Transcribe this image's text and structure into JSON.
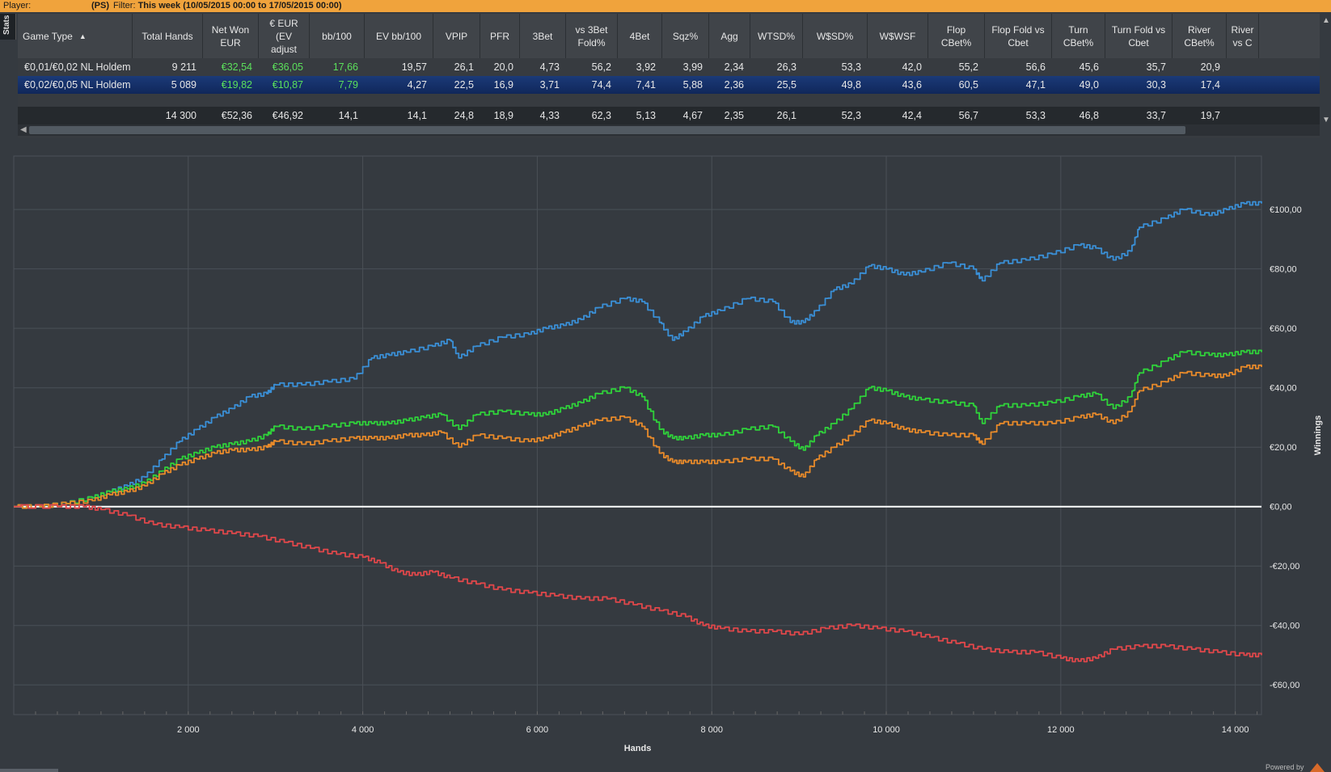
{
  "filterbar": {
    "player_label": "Player:",
    "site": "(PS)",
    "filter_label": "Filter:",
    "filter_value": "This week (10/05/2015 00:00 to 17/05/2015 00:00)"
  },
  "stats_tab": "Stats",
  "table": {
    "columns": [
      {
        "label": "Game Type",
        "sorted": true
      },
      {
        "label": "Total Hands"
      },
      {
        "label": "Net Won EUR"
      },
      {
        "label": "€ EUR (EV adjust"
      },
      {
        "label": "bb/100"
      },
      {
        "label": "EV bb/100"
      },
      {
        "label": "VPIP"
      },
      {
        "label": "PFR"
      },
      {
        "label": "3Bet"
      },
      {
        "label": "vs 3Bet Fold%"
      },
      {
        "label": "4Bet"
      },
      {
        "label": "Sqz%"
      },
      {
        "label": "Agg"
      },
      {
        "label": "WTSD%"
      },
      {
        "label": "W$SD%"
      },
      {
        "label": "W$WSF"
      },
      {
        "label": "Flop CBet%"
      },
      {
        "label": "Flop Fold vs Cbet"
      },
      {
        "label": "Turn CBet%"
      },
      {
        "label": "Turn Fold vs Cbet"
      },
      {
        "label": "River CBet%"
      },
      {
        "label": "River vs C"
      }
    ],
    "rows": [
      [
        "€0,01/€0,02 NL Holdem",
        "9 211",
        "€32,54",
        "€36,05",
        "17,66",
        "19,57",
        "26,1",
        "20,0",
        "4,73",
        "56,2",
        "3,92",
        "3,99",
        "2,34",
        "26,3",
        "53,3",
        "42,0",
        "55,2",
        "56,6",
        "45,6",
        "35,7",
        "20,9",
        ""
      ],
      [
        "€0,02/€0,05 NL Holdem",
        "5 089",
        "€19,82",
        "€10,87",
        "7,79",
        "4,27",
        "22,5",
        "16,9",
        "3,71",
        "74,4",
        "7,41",
        "5,88",
        "2,36",
        "25,5",
        "49,8",
        "43,6",
        "60,5",
        "47,1",
        "49,0",
        "30,3",
        "17,4",
        ""
      ]
    ],
    "totals": [
      "",
      "14 300",
      "€52,36",
      "€46,92",
      "14,1",
      "14,1",
      "24,8",
      "18,9",
      "4,33",
      "62,3",
      "5,13",
      "4,67",
      "2,35",
      "26,1",
      "52,3",
      "42,4",
      "56,7",
      "53,3",
      "46,8",
      "33,7",
      "19,7",
      ""
    ]
  },
  "colors": {
    "blue": "#3a8fd6",
    "green": "#2fd23a",
    "orange": "#e88a2a",
    "red": "#e0474a",
    "zero": "#ffffff",
    "positive_value": "#5be05b"
  },
  "chart_data": {
    "type": "line",
    "xlabel": "Hands",
    "ylabel": "Winnings",
    "xlim": [
      0,
      14300
    ],
    "ylim": [
      -70,
      118
    ],
    "x_ticks": [
      {
        "value": 2000,
        "label": "2 000"
      },
      {
        "value": 4000,
        "label": "4 000"
      },
      {
        "value": 6000,
        "label": "6 000"
      },
      {
        "value": 8000,
        "label": "8 000"
      },
      {
        "value": 10000,
        "label": "10 000"
      },
      {
        "value": 12000,
        "label": "12 000"
      },
      {
        "value": 14000,
        "label": "14 000"
      }
    ],
    "y_ticks": [
      {
        "value": 100,
        "label": "€100,00"
      },
      {
        "value": 80,
        "label": "€80,00"
      },
      {
        "value": 60,
        "label": "€60,00"
      },
      {
        "value": 40,
        "label": "€40,00"
      },
      {
        "value": 20,
        "label": "€20,00"
      },
      {
        "value": 0,
        "label": "€0,00"
      },
      {
        "value": -20,
        "label": "-€20,00"
      },
      {
        "value": -40,
        "label": "-€40,00"
      },
      {
        "value": -60,
        "label": "-€60,00"
      }
    ],
    "grid": true,
    "series": [
      {
        "color": "#3a8fd6",
        "points": [
          [
            0,
            0
          ],
          [
            300,
            0
          ],
          [
            600,
            1
          ],
          [
            900,
            3
          ],
          [
            1100,
            5
          ],
          [
            1300,
            7
          ],
          [
            1500,
            10
          ],
          [
            1700,
            16
          ],
          [
            1900,
            22
          ],
          [
            2100,
            26
          ],
          [
            2300,
            30
          ],
          [
            2500,
            33
          ],
          [
            2700,
            37
          ],
          [
            2900,
            38
          ],
          [
            3000,
            41
          ],
          [
            3300,
            41
          ],
          [
            3600,
            42
          ],
          [
            3900,
            43
          ],
          [
            4100,
            50
          ],
          [
            4300,
            51
          ],
          [
            4500,
            52
          ],
          [
            4800,
            54
          ],
          [
            5000,
            56
          ],
          [
            5100,
            50
          ],
          [
            5300,
            54
          ],
          [
            5600,
            57
          ],
          [
            5900,
            58
          ],
          [
            6100,
            60
          ],
          [
            6300,
            61
          ],
          [
            6500,
            63
          ],
          [
            6700,
            67
          ],
          [
            7000,
            70
          ],
          [
            7200,
            69
          ],
          [
            7400,
            62
          ],
          [
            7550,
            56
          ],
          [
            7700,
            59
          ],
          [
            7900,
            64
          ],
          [
            8100,
            66
          ],
          [
            8400,
            70
          ],
          [
            8700,
            69
          ],
          [
            8900,
            62
          ],
          [
            9050,
            62
          ],
          [
            9200,
            66
          ],
          [
            9400,
            73
          ],
          [
            9600,
            75
          ],
          [
            9800,
            81
          ],
          [
            10000,
            80
          ],
          [
            10200,
            78
          ],
          [
            10400,
            79
          ],
          [
            10700,
            82
          ],
          [
            11000,
            80
          ],
          [
            11100,
            76
          ],
          [
            11300,
            82
          ],
          [
            11600,
            83
          ],
          [
            11900,
            85
          ],
          [
            12200,
            88
          ],
          [
            12400,
            87
          ],
          [
            12600,
            83
          ],
          [
            12800,
            86
          ],
          [
            12900,
            94
          ],
          [
            13200,
            97
          ],
          [
            13400,
            100
          ],
          [
            13700,
            98
          ],
          [
            13900,
            100
          ],
          [
            14100,
            102
          ],
          [
            14300,
            102
          ]
        ]
      },
      {
        "color": "#2fd23a",
        "points": [
          [
            0,
            0
          ],
          [
            300,
            0
          ],
          [
            600,
            1
          ],
          [
            900,
            3
          ],
          [
            1100,
            5
          ],
          [
            1300,
            6
          ],
          [
            1500,
            8
          ],
          [
            1700,
            12
          ],
          [
            1900,
            16
          ],
          [
            2100,
            18
          ],
          [
            2300,
            20
          ],
          [
            2500,
            21
          ],
          [
            2700,
            22
          ],
          [
            2900,
            24
          ],
          [
            3000,
            27
          ],
          [
            3300,
            26
          ],
          [
            3600,
            27
          ],
          [
            3900,
            28
          ],
          [
            4100,
            28
          ],
          [
            4300,
            28
          ],
          [
            4500,
            29
          ],
          [
            4700,
            30
          ],
          [
            4900,
            31
          ],
          [
            5100,
            26
          ],
          [
            5300,
            31
          ],
          [
            5600,
            32
          ],
          [
            5900,
            31
          ],
          [
            6100,
            31
          ],
          [
            6300,
            33
          ],
          [
            6500,
            35
          ],
          [
            6700,
            38
          ],
          [
            7000,
            40
          ],
          [
            7200,
            37
          ],
          [
            7400,
            26
          ],
          [
            7550,
            23
          ],
          [
            7700,
            23
          ],
          [
            7900,
            24
          ],
          [
            8100,
            24
          ],
          [
            8400,
            26
          ],
          [
            8700,
            27
          ],
          [
            8900,
            22
          ],
          [
            9050,
            19
          ],
          [
            9200,
            24
          ],
          [
            9400,
            28
          ],
          [
            9600,
            33
          ],
          [
            9800,
            40
          ],
          [
            10000,
            39
          ],
          [
            10200,
            37
          ],
          [
            10400,
            36
          ],
          [
            10700,
            35
          ],
          [
            11000,
            34
          ],
          [
            11100,
            28
          ],
          [
            11300,
            34
          ],
          [
            11600,
            34
          ],
          [
            11900,
            35
          ],
          [
            12200,
            37
          ],
          [
            12400,
            38
          ],
          [
            12600,
            33
          ],
          [
            12800,
            37
          ],
          [
            12900,
            45
          ],
          [
            13200,
            49
          ],
          [
            13400,
            52
          ],
          [
            13700,
            51
          ],
          [
            13900,
            51
          ],
          [
            14100,
            52
          ],
          [
            14300,
            52
          ]
        ]
      },
      {
        "color": "#e88a2a",
        "points": [
          [
            0,
            0
          ],
          [
            300,
            0
          ],
          [
            600,
            1
          ],
          [
            900,
            2
          ],
          [
            1100,
            4
          ],
          [
            1300,
            5
          ],
          [
            1500,
            7
          ],
          [
            1700,
            11
          ],
          [
            1900,
            14
          ],
          [
            2100,
            16
          ],
          [
            2300,
            18
          ],
          [
            2500,
            19
          ],
          [
            2700,
            19
          ],
          [
            2900,
            20
          ],
          [
            3000,
            22
          ],
          [
            3300,
            21
          ],
          [
            3600,
            22
          ],
          [
            3900,
            23
          ],
          [
            4100,
            23
          ],
          [
            4300,
            23
          ],
          [
            4500,
            24
          ],
          [
            4700,
            24
          ],
          [
            4900,
            25
          ],
          [
            5100,
            20
          ],
          [
            5300,
            24
          ],
          [
            5600,
            23
          ],
          [
            5900,
            22
          ],
          [
            6100,
            23
          ],
          [
            6300,
            25
          ],
          [
            6500,
            27
          ],
          [
            6700,
            29
          ],
          [
            7000,
            30
          ],
          [
            7200,
            27
          ],
          [
            7400,
            18
          ],
          [
            7550,
            15
          ],
          [
            7700,
            15
          ],
          [
            7900,
            15
          ],
          [
            8100,
            15
          ],
          [
            8400,
            16
          ],
          [
            8700,
            16
          ],
          [
            8900,
            12
          ],
          [
            9050,
            10
          ],
          [
            9200,
            16
          ],
          [
            9400,
            20
          ],
          [
            9600,
            24
          ],
          [
            9800,
            29
          ],
          [
            10000,
            28
          ],
          [
            10200,
            26
          ],
          [
            10400,
            25
          ],
          [
            10700,
            24
          ],
          [
            11000,
            24
          ],
          [
            11100,
            21
          ],
          [
            11300,
            28
          ],
          [
            11600,
            28
          ],
          [
            11900,
            28
          ],
          [
            12200,
            30
          ],
          [
            12400,
            31
          ],
          [
            12600,
            28
          ],
          [
            12800,
            32
          ],
          [
            12900,
            39
          ],
          [
            13200,
            42
          ],
          [
            13400,
            45
          ],
          [
            13700,
            44
          ],
          [
            13900,
            44
          ],
          [
            14100,
            47
          ],
          [
            14300,
            47
          ]
        ]
      },
      {
        "color": "#e0474a",
        "points": [
          [
            0,
            0
          ],
          [
            500,
            0
          ],
          [
            800,
            0
          ],
          [
            1000,
            -1
          ],
          [
            1300,
            -3
          ],
          [
            1600,
            -6
          ],
          [
            1900,
            -7
          ],
          [
            2200,
            -8
          ],
          [
            2500,
            -9
          ],
          [
            2800,
            -10
          ],
          [
            3100,
            -12
          ],
          [
            3400,
            -14
          ],
          [
            3700,
            -16
          ],
          [
            4000,
            -17
          ],
          [
            4200,
            -19
          ],
          [
            4400,
            -22
          ],
          [
            4600,
            -23
          ],
          [
            4800,
            -22
          ],
          [
            5000,
            -24
          ],
          [
            5300,
            -26
          ],
          [
            5600,
            -28
          ],
          [
            5900,
            -29
          ],
          [
            6200,
            -30
          ],
          [
            6500,
            -31
          ],
          [
            6800,
            -31
          ],
          [
            7100,
            -33
          ],
          [
            7400,
            -35
          ],
          [
            7700,
            -37
          ],
          [
            7900,
            -40
          ],
          [
            8100,
            -41
          ],
          [
            8400,
            -42
          ],
          [
            8700,
            -42
          ],
          [
            9000,
            -43
          ],
          [
            9300,
            -41
          ],
          [
            9600,
            -40
          ],
          [
            9900,
            -41
          ],
          [
            10200,
            -42
          ],
          [
            10500,
            -44
          ],
          [
            10800,
            -46
          ],
          [
            11100,
            -48
          ],
          [
            11400,
            -49
          ],
          [
            11700,
            -49
          ],
          [
            12000,
            -51
          ],
          [
            12200,
            -52
          ],
          [
            12400,
            -51
          ],
          [
            12600,
            -48
          ],
          [
            12900,
            -47
          ],
          [
            13200,
            -47
          ],
          [
            13500,
            -48
          ],
          [
            13800,
            -49
          ],
          [
            14100,
            -50
          ],
          [
            14300,
            -50
          ]
        ]
      }
    ]
  },
  "powered_by": "Powered by"
}
